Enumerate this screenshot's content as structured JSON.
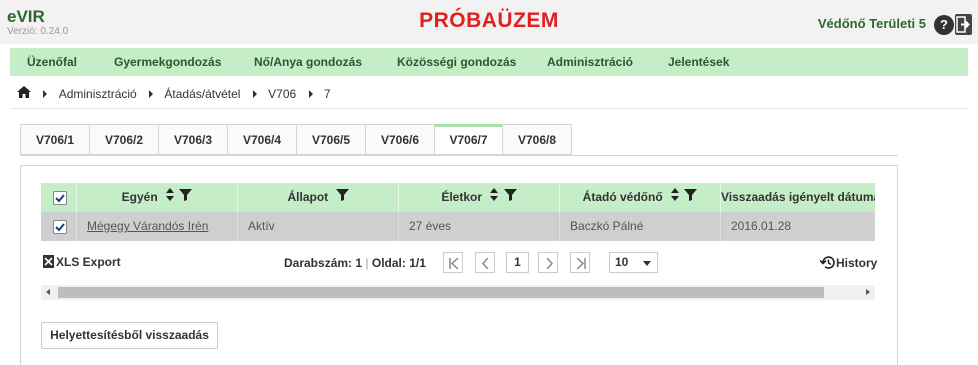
{
  "header": {
    "app_title": "eVIR",
    "version": "Verzió: 0.24.0",
    "banner": "PRÓBAÜZEM",
    "user_name": "Védőnő Területi 5",
    "help_label": "?"
  },
  "nav": {
    "items": [
      "Üzenőfal",
      "Gyermekgondozás",
      "Nő/Anya gondozás",
      "Közösségi gondozás",
      "Adminisztráció",
      "Jelentések"
    ]
  },
  "breadcrumb": {
    "items": [
      "Adminisztráció",
      "Átadás/átvétel",
      "V706",
      "7"
    ]
  },
  "tabs": {
    "items": [
      "V706/1",
      "V706/2",
      "V706/3",
      "V706/4",
      "V706/5",
      "V706/6",
      "V706/7",
      "V706/8"
    ],
    "active_index": 6
  },
  "grid": {
    "columns": [
      "Egyén",
      "Állapot",
      "Életkor",
      "Átadó védőnő",
      "Visszaadás igényelt dátuma"
    ],
    "rows": [
      {
        "checked": true,
        "cells": [
          "Mégegy Várandós Irén",
          "Aktív",
          "27 éves",
          "Baczkó Pálné",
          "2016.01.28"
        ]
      }
    ]
  },
  "toolbar": {
    "xls_label": "XLS Export",
    "count_label": "Darabszám:",
    "count_value": "1",
    "page_label": "Oldal:",
    "page_value": "1/1",
    "current_page": "1",
    "page_size": "10",
    "history_label": "History"
  },
  "actions": {
    "return_button": "Helyettesítésből visszaadás"
  },
  "colors": {
    "accent_green": "#c5eec8",
    "brand_text": "#2a6a2a",
    "banner_red": "#e02020"
  }
}
